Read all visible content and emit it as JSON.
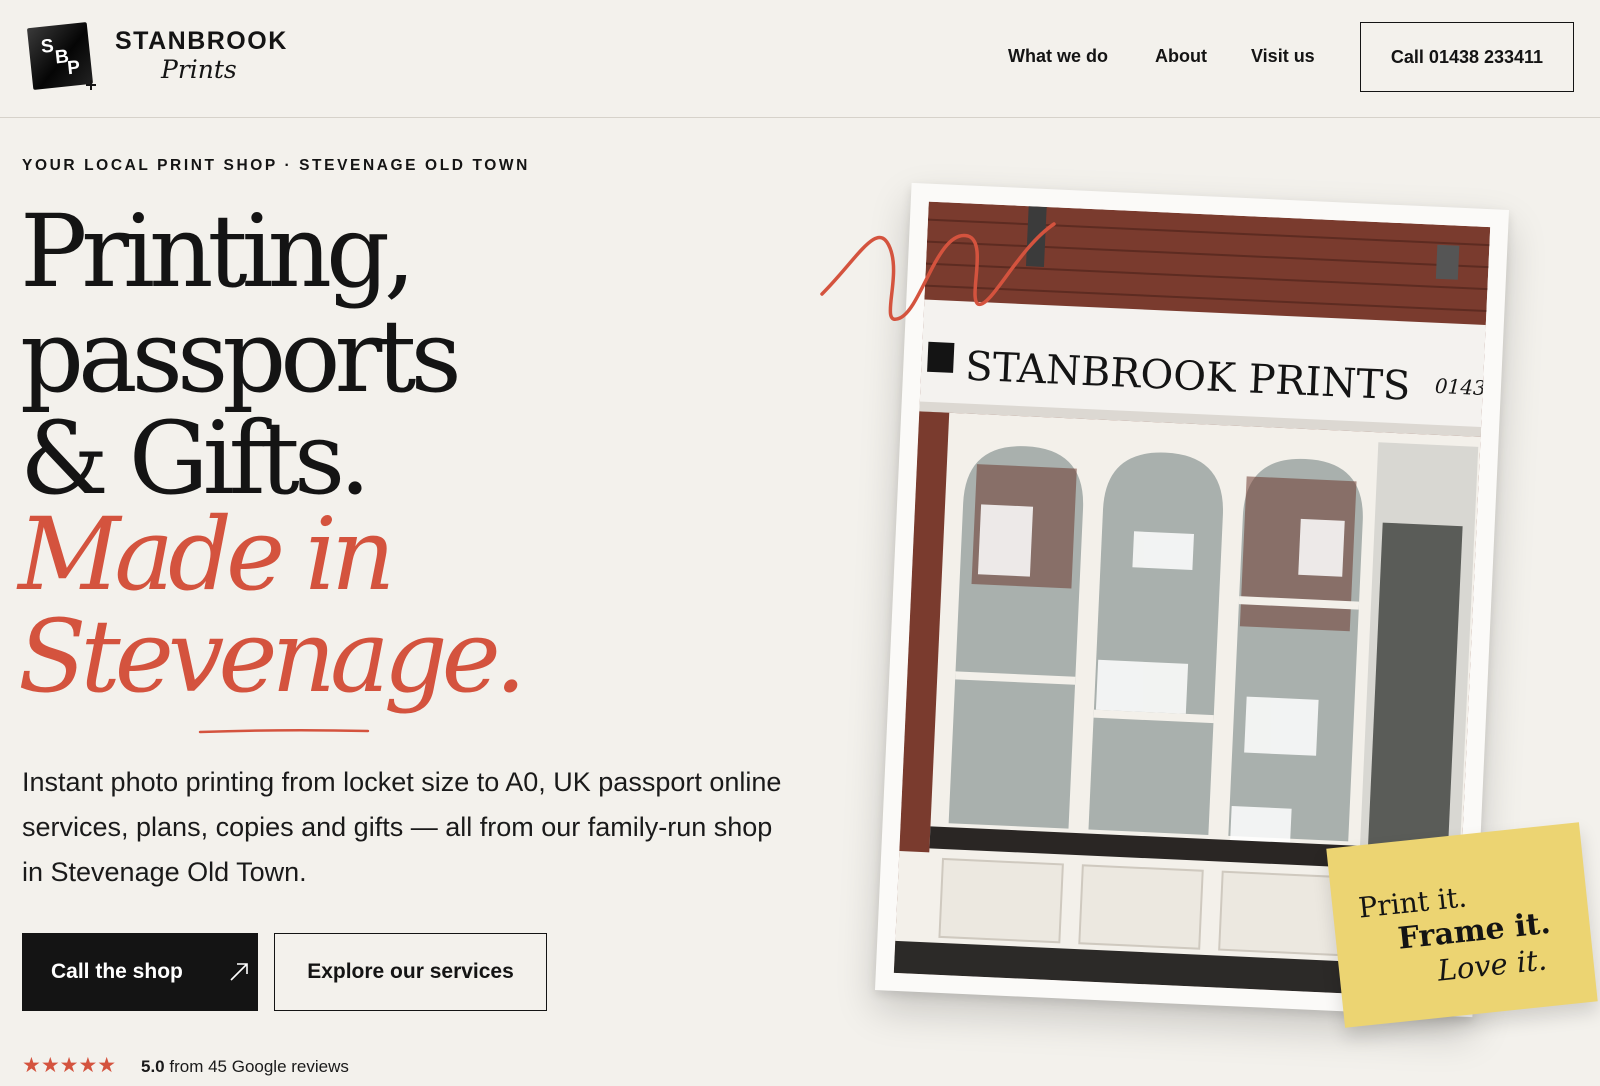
{
  "brand": {
    "logo_letters": [
      "S",
      "B",
      "P"
    ],
    "name": "STANBROOK",
    "sub": "Prints"
  },
  "nav": {
    "items": [
      "What we do",
      "About",
      "Visit us"
    ],
    "call_label": "Call 01438 233411"
  },
  "hero": {
    "eyebrow": "YOUR LOCAL PRINT SHOP · STEVENAGE OLD TOWN",
    "headline": [
      "Printing,",
      "passports",
      "& Gifts."
    ],
    "headline_italic": [
      "Made in",
      "Stevenage."
    ],
    "description": "Instant photo printing from locket size to A0, UK passport online services, plans, copies and gifts — all from our family-run shop in Stevenage Old Town.",
    "primary_button": "Call the shop",
    "secondary_button": "Explore our services",
    "stars": "★★★★★",
    "rating_value": "5.0",
    "rating_text": " from 45 Google reviews"
  },
  "photo": {
    "shop_sign": "STANBROOK PRINTS",
    "sign_phone": "0143"
  },
  "sticky_note": {
    "line1": "Print it.",
    "line2": "Frame it.",
    "line3": "Love it."
  },
  "colors": {
    "background": "#f3f1ec",
    "accent": "#d4533e",
    "ink": "#141414",
    "sticky": "#ecd472"
  }
}
